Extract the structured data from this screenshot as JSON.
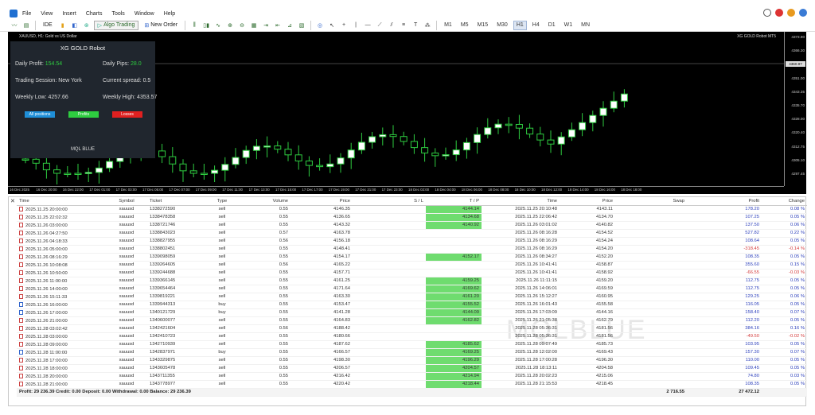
{
  "menu": [
    "File",
    "View",
    "Insert",
    "Charts",
    "Tools",
    "Window",
    "Help"
  ],
  "toolbar": {
    "ide_label": "IDE",
    "algo_trading_label": "Algo Trading",
    "new_order_label": "New Order",
    "timeframes": [
      "M1",
      "M5",
      "M15",
      "M30",
      "H1",
      "H4",
      "D1",
      "W1",
      "MN"
    ],
    "active_timeframe": "H1"
  },
  "chart": {
    "symbol_title": "XAUUSD, H1:  Gold vs US Dollar",
    "ea_title": "XG GOLD Robot MT5",
    "price_ticks": [
      "4373.90",
      "4366.30",
      "4358.70",
      "4351.00",
      "4343.35",
      "4335.70",
      "4328.00",
      "4320.40",
      "4312.75",
      "4305.10",
      "4297.45"
    ],
    "current_price": "4360.97",
    "time_ticks": [
      "16 Dec 2025",
      "16 Dec 20:00",
      "16 Dec 22:00",
      "17 Dec 01:00",
      "17 Dec 03:00",
      "17 Dec 05:00",
      "17 Dec 07:00",
      "17 Dec 09:00",
      "17 Dec 11:00",
      "17 Dec 13:00",
      "17 Dec 15:00",
      "17 Dec 17:00",
      "17 Dec 19:00",
      "17 Dec 21:00",
      "17 Dec 23:00",
      "18 Dec 02:00",
      "18 Dec 04:00",
      "18 Dec 06:00",
      "18 Dec 08:00",
      "18 Dec 10:00",
      "18 Dec 12:00",
      "18 Dec 14:00",
      "18 Dec 16:00",
      "18 Dec 18:00"
    ]
  },
  "panel": {
    "title": "XG GOLD Robot",
    "daily_profit_label": "Daily Profit:",
    "daily_profit_value": "154.54",
    "daily_pips_label": "Daily Pips:",
    "daily_pips_value": "28.0",
    "session_label": "Trading Session: New York",
    "spread_label": "Current spread: 0.5",
    "weekly_low_label": "Weekly Low: 4257.66",
    "weekly_high_label": "Weekly High: 4353.57",
    "btn_all": "All positions",
    "btn_profits": "Profits",
    "btn_losses": "Losses",
    "footer": "MQL BLUE",
    "colors": {
      "bg": "#20262e",
      "all": "#1f8fd8",
      "profits": "#2ecc40",
      "losses": "#e02020"
    }
  },
  "table": {
    "headers": [
      "Time",
      "Symbol",
      "Ticket",
      "Type",
      "Volume",
      "Price",
      "S / L",
      "T / P",
      "Time",
      "Price",
      "Swap",
      "Profit",
      "Change"
    ],
    "rows": [
      [
        "2025.11.25 20:00:00",
        "xauusd",
        "1338272590",
        "sell",
        "0.55",
        "4146.35",
        "",
        "4144.14",
        "2025.11.25 20:10:48",
        "4143.11",
        "",
        "178.20",
        "0.08 %"
      ],
      [
        "2025.11.25 22:02:32",
        "xauusd",
        "1338478358",
        "sell",
        "0.55",
        "4136.65",
        "",
        "4134.68",
        "2025.11.25 22:06:42",
        "4134.70",
        "",
        "107.25",
        "0.05 %"
      ],
      [
        "2025.11.26 03:00:00",
        "xauusd",
        "1338721746",
        "sell",
        "0.55",
        "4143.32",
        "",
        "4140.92",
        "2025.11.26 03:01:02",
        "4140.82",
        "",
        "137.50",
        "0.06 %"
      ],
      [
        "2025.11.26 04:27:50",
        "xauusd",
        "1338843023",
        "sell",
        "0.57",
        "4163.78",
        "",
        "",
        "2025.11.26 08:16:28",
        "4154.52",
        "",
        "527.82",
        "0.22 %"
      ],
      [
        "2025.11.26 04:18:33",
        "xauusd",
        "1338827955",
        "sell",
        "0.56",
        "4156.18",
        "",
        "",
        "2025.11.26 08:16:29",
        "4154.24",
        "",
        "108.64",
        "0.05 %"
      ],
      [
        "2025.11.26 05:00:00",
        "xauusd",
        "1338802451",
        "sell",
        "0.55",
        "4148.41",
        "",
        "",
        "2025.11.26 08:16:29",
        "4154.20",
        "",
        "-318.45",
        "-0.14 %"
      ],
      [
        "2025.11.26 08:16:29",
        "xauusd",
        "1339098059",
        "sell",
        "0.55",
        "4154.17",
        "",
        "4152.17",
        "2025.11.26 08:34:27",
        "4152.20",
        "",
        "108.35",
        "0.05 %"
      ],
      [
        "2025.11.26 10:08:08",
        "xauusd",
        "1339264605",
        "sell",
        "0.56",
        "4165.22",
        "",
        "",
        "2025.11.26 10:41:41",
        "4158.87",
        "",
        "355.60",
        "0.15 %"
      ],
      [
        "2025.11.26 10:50:00",
        "xauusd",
        "1339244688",
        "sell",
        "0.55",
        "4157.71",
        "",
        "",
        "2025.11.26 10:41:41",
        "4158.92",
        "",
        "-66.55",
        "-0.03 %"
      ],
      [
        "2025.11.26 11:00:00",
        "xauusd",
        "1339366145",
        "sell",
        "0.55",
        "4161.25",
        "",
        "4159.25",
        "2025.11.26 11:11:15",
        "4159.20",
        "",
        "112.75",
        "0.05 %"
      ],
      [
        "2025.11.26 14:00:00",
        "xauusd",
        "1339654464",
        "sell",
        "0.55",
        "4171.64",
        "",
        "4169.62",
        "2025.11.26 14:06:01",
        "4169.59",
        "",
        "112.75",
        "0.05 %"
      ],
      [
        "2025.11.26 15:11:33",
        "xauusd",
        "1339819221",
        "sell",
        "0.55",
        "4163.30",
        "",
        "4161.20",
        "2025.11.26 15:12:27",
        "4160.95",
        "",
        "129.25",
        "0.06 %"
      ],
      [
        "2025.11.26 16:00:00",
        "xauusd",
        "1339944313",
        "buy",
        "0.55",
        "4153.47",
        "",
        "4155.52",
        "2025.11.26 16:01:43",
        "4155.58",
        "",
        "116.05",
        "0.05 %"
      ],
      [
        "2025.11.26 17:00:00",
        "xauusd",
        "1340121729",
        "buy",
        "0.55",
        "4141.28",
        "",
        "4144.09",
        "2025.11.26 17:03:09",
        "4144.16",
        "",
        "158.40",
        "0.07 %"
      ],
      [
        "2025.11.26 21:00:00",
        "xauusd",
        "1340600077",
        "sell",
        "0.55",
        "4164.83",
        "",
        "4162.82",
        "2025.11.26 21:05:38",
        "4162.79",
        "",
        "112.20",
        "0.05 %"
      ],
      [
        "2025.11.28 03:02:42",
        "xauusd",
        "1342421604",
        "sell",
        "0.56",
        "4188.42",
        "",
        "",
        "2025.11.28 05:36:31",
        "4181.56",
        "",
        "384.16",
        "0.16 %"
      ],
      [
        "2025.11.28 03:00:00",
        "xauusd",
        "1342410723",
        "sell",
        "0.55",
        "4180.66",
        "",
        "",
        "2025.11.28 05:36:31",
        "4181.56",
        "",
        "-49.50",
        "-0.02 %"
      ],
      [
        "2025.11.28 09:00:00",
        "xauusd",
        "1342710939",
        "sell",
        "0.55",
        "4187.62",
        "",
        "4185.62",
        "2025.11.28 09:07:49",
        "4185.73",
        "",
        "103.95",
        "0.05 %"
      ],
      [
        "2025.11.28 11:00:00",
        "xauusd",
        "1342837971",
        "buy",
        "0.55",
        "4166.57",
        "",
        "4169.25",
        "2025.11.28 12:02:00",
        "4169.43",
        "",
        "157.30",
        "0.07 %"
      ],
      [
        "2025.11.28 17:00:00",
        "xauusd",
        "1343329875",
        "sell",
        "0.55",
        "4198.30",
        "",
        "4196.29",
        "2025.11.28 17:00:28",
        "4196.30",
        "",
        "110.00",
        "0.05 %"
      ],
      [
        "2025.11.28 18:00:00",
        "xauusd",
        "1343605478",
        "sell",
        "0.55",
        "4206.57",
        "",
        "4204.57",
        "2025.11.28 18:13:11",
        "4204.58",
        "",
        "109.45",
        "0.05 %"
      ],
      [
        "2025.11.28 20:00:00",
        "xauusd",
        "1343711355",
        "sell",
        "0.55",
        "4216.42",
        "",
        "4214.94",
        "2025.11.28 20:02:23",
        "4215.06",
        "",
        "74.80",
        "0.03 %"
      ],
      [
        "2025.11.28 21:00:00",
        "xauusd",
        "1343778977",
        "sell",
        "0.55",
        "4220.42",
        "",
        "4218.44",
        "2025.11.28 21:15:53",
        "4218.45",
        "",
        "108.35",
        "0.05 %"
      ]
    ],
    "totals": {
      "summary": "Profit: 29 236.39  Credit: 0.00  Deposit: 0.00  Withdrawal: 0.00  Balance: 29 236.39",
      "swap": "2 716.55",
      "profit": "27 472.12"
    },
    "watermark": "MQLBLUE"
  }
}
